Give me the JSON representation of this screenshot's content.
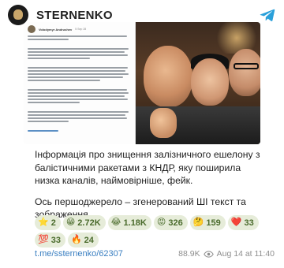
{
  "channel": {
    "name": "STERNENKO"
  },
  "media": {
    "doc_author": "Volodymyr Andrushev",
    "doc_date": "5 Sep 28"
  },
  "message": {
    "paragraph1": "Інформація про знищення залізничного ешелону з балістичними ракетами з КНДР, яку поширила низка каналів, наймовірніше, фейк.",
    "paragraph2": "Ось першоджерело – згенерований ШІ текст та зображення."
  },
  "reactions": [
    {
      "emoji": "⭐",
      "count": "2"
    },
    {
      "emoji": "😁",
      "count": "2.72K"
    },
    {
      "emoji": "😂",
      "count": "1.18K"
    },
    {
      "emoji": "😡",
      "count": "326"
    },
    {
      "emoji": "🤔",
      "count": "159"
    },
    {
      "emoji": "❤️",
      "count": "33"
    },
    {
      "emoji": "💯",
      "count": "33"
    },
    {
      "emoji": "🔥",
      "count": "24"
    }
  ],
  "footer": {
    "link": "t.me/ssternenko/62307",
    "views": "88.9K",
    "date": "Aug 14 at 11:40"
  },
  "colors": {
    "link": "#3a7fc1",
    "reaction_bg": "#e6ecd9",
    "reaction_text": "#4a6b2c",
    "telegram": "#2aa0da"
  },
  "icons": {
    "telegram": "telegram-icon",
    "views": "eye-icon"
  }
}
